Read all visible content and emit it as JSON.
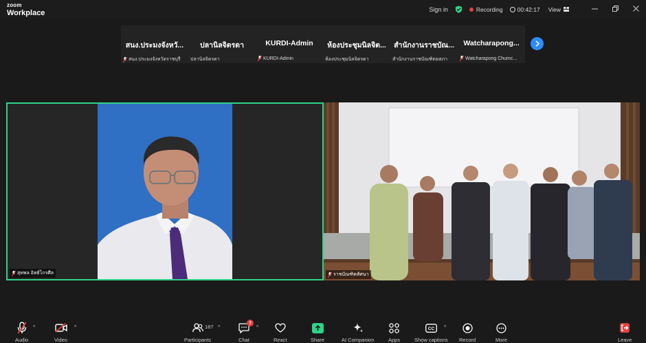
{
  "app": {
    "logo_top": "zoom",
    "logo_bottom": "Workplace"
  },
  "titlebar": {
    "sign_in": "Sign in",
    "recording_label": "Recording",
    "timer": "00:42:17",
    "view_label": "View",
    "recording_color": "#e34141",
    "shield_color": "#2ed38a"
  },
  "thumbnails": [
    {
      "name": "สนง.ประมงจังหวั...",
      "sub": "สนง.ประมงจังหวัดราชบุรี",
      "muted": true
    },
    {
      "name": "ปลานิลจิตรดา",
      "sub": "ปลานิลจิตรดา",
      "muted": false
    },
    {
      "name": "KURDI-Admin",
      "sub": "KURDI-Admin",
      "muted": true
    },
    {
      "name": "ห้องประชุมนิลจิต...",
      "sub": "ห้องประชุมนิลจิตรดา",
      "muted": false
    },
    {
      "name": "สำนักงานราชบัณ...",
      "sub": "สำนักงานราชบัณฑิตยสภา",
      "muted": false
    },
    {
      "name": "Watcharapong...",
      "sub": "Watcharapong Chumc...",
      "muted": true
    }
  ],
  "video": {
    "left_label": "สุทพล อิทธิไกรศีล",
    "right_label": "ราชบัณฑิตทัศนา",
    "active_speaker_color": "#2ed38a"
  },
  "toolbar": {
    "audio": "Audio",
    "video": "Video",
    "participants": "Participants",
    "participants_count": "187",
    "chat": "Chat",
    "chat_badge": "7",
    "react": "React",
    "share": "Share",
    "ai_companion": "AI Companion",
    "apps": "Apps",
    "show_captions": "Show captions",
    "record": "Record",
    "more": "More",
    "leave": "Leave",
    "share_color": "#2ed38a",
    "alert_color": "#e34141"
  }
}
